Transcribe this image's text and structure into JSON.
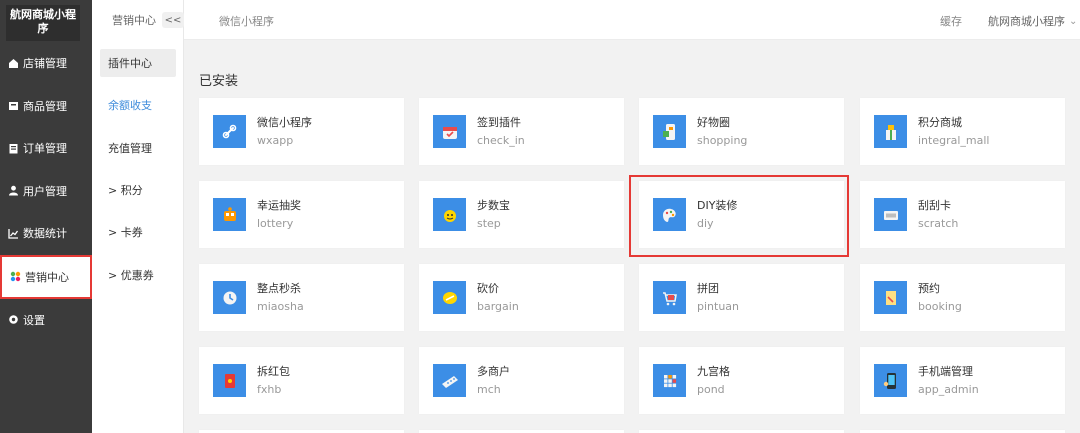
{
  "app": {
    "name": "航网商城小程序"
  },
  "sidebar": {
    "items": [
      {
        "label": "店铺管理",
        "icon": "home-icon"
      },
      {
        "label": "商品管理",
        "icon": "box-icon"
      },
      {
        "label": "订单管理",
        "icon": "order-icon"
      },
      {
        "label": "用户管理",
        "icon": "user-icon"
      },
      {
        "label": "数据统计",
        "icon": "chart-icon"
      },
      {
        "label": "营销中心",
        "icon": "marketing-icon"
      },
      {
        "label": "设置",
        "icon": "gear-icon"
      }
    ]
  },
  "subnav": {
    "header": "营销中心",
    "collapse": "<<",
    "items": [
      {
        "label": "插件中心"
      },
      {
        "label": "余额收支"
      },
      {
        "label": "充值管理"
      },
      {
        "label": "> 积分"
      },
      {
        "label": "> 卡券"
      },
      {
        "label": "> 优惠券"
      }
    ]
  },
  "topbar": {
    "title": "微信小程序",
    "cache": "缓存",
    "user": "航网商城小程序",
    "caret": "⌄"
  },
  "main": {
    "section": "已安装",
    "plugins": [
      {
        "name": "微信小程序",
        "key": "wxapp"
      },
      {
        "name": "签到插件",
        "key": "check_in"
      },
      {
        "name": "好物圈",
        "key": "shopping"
      },
      {
        "name": "积分商城",
        "key": "integral_mall"
      },
      {
        "name": "幸运抽奖",
        "key": "lottery"
      },
      {
        "name": "步数宝",
        "key": "step"
      },
      {
        "name": "DIY装修",
        "key": "diy"
      },
      {
        "name": "刮刮卡",
        "key": "scratch"
      },
      {
        "name": "整点秒杀",
        "key": "miaosha"
      },
      {
        "name": "砍价",
        "key": "bargain"
      },
      {
        "name": "拼团",
        "key": "pintuan"
      },
      {
        "name": "预约",
        "key": "booking"
      },
      {
        "name": "拆红包",
        "key": "fxhb"
      },
      {
        "name": "多商户",
        "key": "mch"
      },
      {
        "name": "九宫格",
        "key": "pond"
      },
      {
        "name": "手机端管理",
        "key": "app_admin"
      }
    ]
  },
  "colors": {
    "accent": "#3c8ee6",
    "sidebar": "#3b3b3b",
    "highlight": "#e53935"
  }
}
